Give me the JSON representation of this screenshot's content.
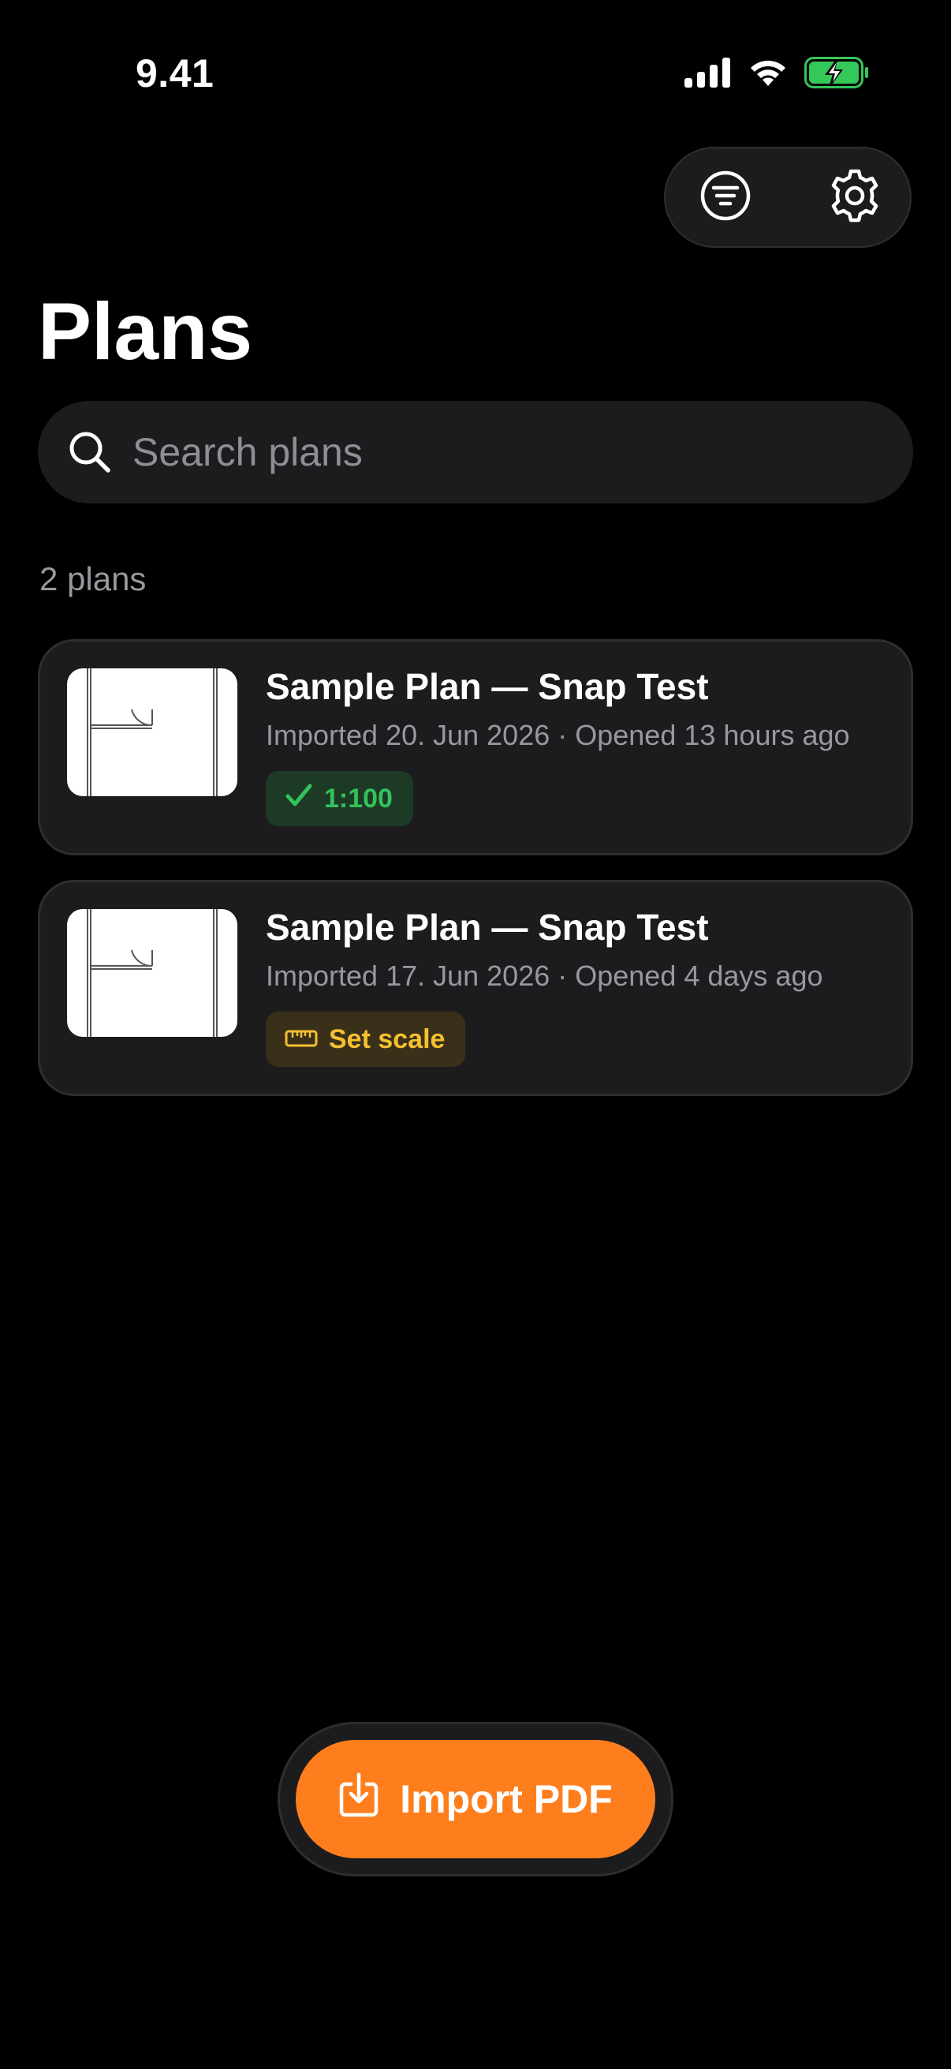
{
  "status_bar": {
    "time": "9.41",
    "icons": [
      "cellular-signal-icon",
      "wifi-icon",
      "battery-charging-icon"
    ],
    "battery_color": "#34c759"
  },
  "toolbar": {
    "icons": [
      "filter-icon",
      "gear-icon"
    ]
  },
  "header": {
    "title": "Plans"
  },
  "search": {
    "placeholder": "Search plans",
    "value": ""
  },
  "list": {
    "count_label": "2 plans",
    "plans": [
      {
        "title": "Sample Plan — Snap Test",
        "meta": "Imported 20. Jun 2026 · Opened 13 hours ago",
        "badge": {
          "type": "scale-set",
          "icon": "checkmark-icon",
          "label": "1:100",
          "color": "#32c25a"
        }
      },
      {
        "title": "Sample Plan — Snap Test",
        "meta": "Imported 17. Jun 2026 · Opened 4 days ago",
        "badge": {
          "type": "scale-unset",
          "icon": "ruler-icon",
          "label": "Set scale",
          "color": "#f5c030"
        }
      }
    ]
  },
  "import": {
    "label": "Import PDF",
    "icon": "import-tray-icon",
    "accent": "#fe7e1e"
  }
}
